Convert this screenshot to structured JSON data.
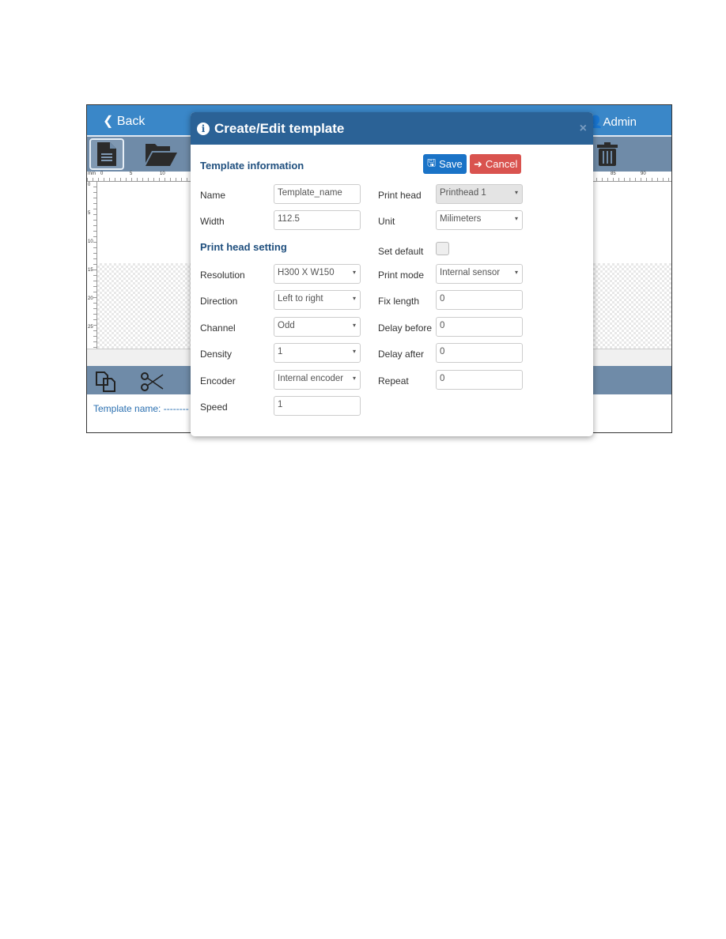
{
  "app": {
    "back_label": "Back",
    "user_label": "Admin",
    "template_name_label": "Template name:",
    "template_name_value": "--------",
    "ruler_unit": "mm",
    "ruler_h_ticks": [
      "0",
      "5",
      "10",
      "85",
      "90"
    ],
    "ruler_v_ticks": [
      "0",
      "5",
      "10",
      "15",
      "20",
      "25"
    ]
  },
  "modal": {
    "title": "Create/Edit template",
    "close_label": "×",
    "save_label": "Save",
    "cancel_label": "Cancel",
    "section_info": "Template information",
    "section_printhead": "Print head setting",
    "left_fields": [
      {
        "label": "Name",
        "value": "Template_name",
        "type": "text"
      },
      {
        "label": "Width",
        "value": "112.5",
        "type": "text"
      },
      {
        "label": "Resolution",
        "value": "H300 X W150",
        "type": "select"
      },
      {
        "label": "Direction",
        "value": "Left to right",
        "type": "select"
      },
      {
        "label": "Channel",
        "value": "Odd",
        "type": "select"
      },
      {
        "label": "Density",
        "value": "1",
        "type": "select"
      },
      {
        "label": "Encoder",
        "value": "Internal encoder",
        "type": "select"
      },
      {
        "label": "Speed",
        "value": "1",
        "type": "text"
      }
    ],
    "right_fields": [
      {
        "label": "Print head",
        "value": "Printhead 1",
        "type": "select",
        "disabled": true
      },
      {
        "label": "Unit",
        "value": "Milimeters",
        "type": "select"
      },
      {
        "label": "Set default",
        "checked": false,
        "type": "checkbox"
      },
      {
        "label": "Print mode",
        "value": "Internal sensor",
        "type": "select"
      },
      {
        "label": "Fix length",
        "value": "0",
        "type": "text"
      },
      {
        "label": "Delay before",
        "value": "0",
        "type": "text"
      },
      {
        "label": "Delay after",
        "value": "0",
        "type": "text"
      },
      {
        "label": "Repeat",
        "value": "0",
        "type": "text"
      }
    ]
  },
  "colors": {
    "header": "#3a87c8",
    "modal_header": "#2b6296",
    "save": "#1a73c7",
    "cancel": "#d9534f",
    "toolbar": "#6f8ba8"
  }
}
